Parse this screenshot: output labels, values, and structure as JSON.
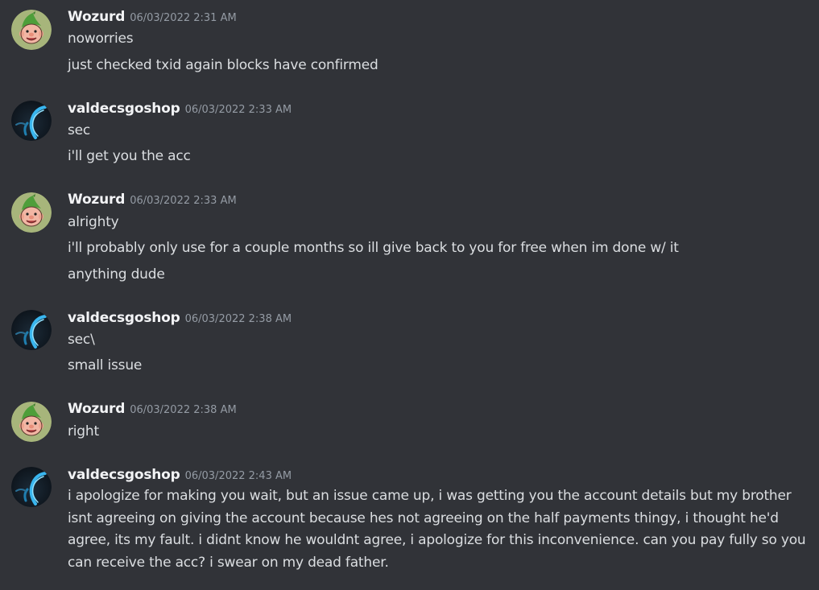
{
  "colors": {
    "background": "#313338",
    "username": "#f2f3f5",
    "timestamp": "#949ba4",
    "message_text": "#dbdee1"
  },
  "messages": [
    {
      "author": "Wozurd",
      "avatar_icon": "gnome-avatar-icon",
      "timestamp": "06/03/2022 2:31 AM",
      "lines": [
        "noworries",
        "just checked txid again blocks have confirmed"
      ]
    },
    {
      "author": "valdecsgoshop",
      "avatar_icon": "blue-swirl-avatar-icon",
      "timestamp": "06/03/2022 2:33 AM",
      "lines": [
        "sec",
        "i'll get you the acc"
      ]
    },
    {
      "author": "Wozurd",
      "avatar_icon": "gnome-avatar-icon",
      "timestamp": "06/03/2022 2:33 AM",
      "lines": [
        "alrighty",
        "i'll probably only use for a couple months so ill give back to you for free when im done w/ it",
        "anything dude"
      ]
    },
    {
      "author": "valdecsgoshop",
      "avatar_icon": "blue-swirl-avatar-icon",
      "timestamp": "06/03/2022 2:38 AM",
      "lines": [
        "sec\\",
        "small issue"
      ]
    },
    {
      "author": "Wozurd",
      "avatar_icon": "gnome-avatar-icon",
      "timestamp": "06/03/2022 2:38 AM",
      "lines": [
        "right"
      ]
    },
    {
      "author": "valdecsgoshop",
      "avatar_icon": "blue-swirl-avatar-icon",
      "timestamp": "06/03/2022 2:43 AM",
      "lines": [
        "i apologize for making you wait, but an issue came up, i was getting you the account details  but my brother isnt agreeing on giving the account  because hes not agreeing on the half payments thingy, i thought he'd agree, its my fault. i didnt know he wouldnt agree,  i apologize for this inconvenience. can you pay fully so you can receive the acc? i swear on my dead father."
      ]
    }
  ]
}
